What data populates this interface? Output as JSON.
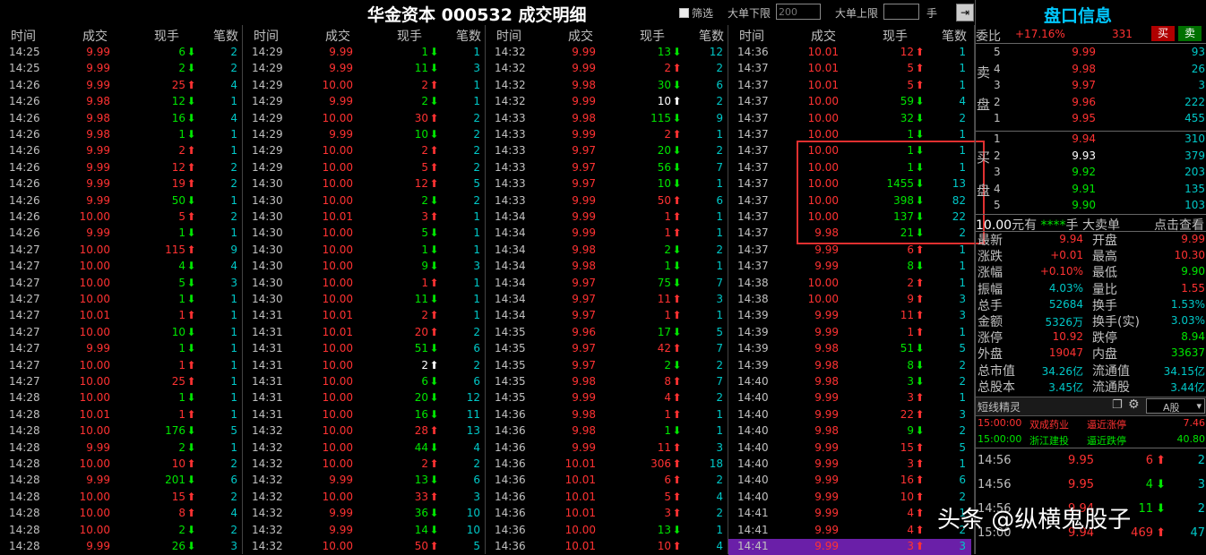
{
  "window": {
    "title": "华金资本 000532 成交明细",
    "filter_label": "筛选",
    "min_label": "大单下限",
    "min_value": "200",
    "max_label": "大单上限",
    "max_value": "",
    "unit_label": "手",
    "exit_icon": "exit-arrow-icon"
  },
  "headers": {
    "time": "时间",
    "price": "成交",
    "vol": "现手",
    "count": "笔数"
  },
  "colors": {
    "up": "#ff3232",
    "down": "#00e600",
    "neutral": "#ffffff",
    "count": "#00c8c8",
    "highlight": "#6a1fa8",
    "box": "#e03030"
  },
  "trades": [
    [
      [
        "14:25",
        "9.99",
        "6",
        "d",
        "2"
      ],
      [
        "14:25",
        "9.99",
        "2",
        "d",
        "2"
      ],
      [
        "14:26",
        "9.99",
        "25",
        "u",
        "4"
      ],
      [
        "14:26",
        "9.98",
        "12",
        "d",
        "1"
      ],
      [
        "14:26",
        "9.98",
        "16",
        "d",
        "4"
      ],
      [
        "14:26",
        "9.98",
        "1",
        "d",
        "1"
      ],
      [
        "14:26",
        "9.99",
        "2",
        "u",
        "1"
      ],
      [
        "14:26",
        "9.99",
        "12",
        "u",
        "2"
      ],
      [
        "14:26",
        "9.99",
        "19",
        "u",
        "2"
      ],
      [
        "14:26",
        "9.99",
        "50",
        "d",
        "1"
      ],
      [
        "14:26",
        "10.00",
        "5",
        "u",
        "2"
      ],
      [
        "14:26",
        "9.99",
        "1",
        "d",
        "1"
      ],
      [
        "14:27",
        "10.00",
        "115",
        "u",
        "9"
      ],
      [
        "14:27",
        "10.00",
        "4",
        "d",
        "4"
      ],
      [
        "14:27",
        "10.00",
        "5",
        "d",
        "3"
      ],
      [
        "14:27",
        "10.00",
        "1",
        "d",
        "1"
      ],
      [
        "14:27",
        "10.01",
        "1",
        "u",
        "1"
      ],
      [
        "14:27",
        "10.00",
        "10",
        "d",
        "1"
      ],
      [
        "14:27",
        "9.99",
        "1",
        "d",
        "1"
      ],
      [
        "14:27",
        "10.00",
        "1",
        "u",
        "1"
      ],
      [
        "14:27",
        "10.00",
        "25",
        "u",
        "1"
      ],
      [
        "14:28",
        "10.00",
        "1",
        "d",
        "1"
      ],
      [
        "14:28",
        "10.01",
        "1",
        "u",
        "1"
      ],
      [
        "14:28",
        "10.00",
        "176",
        "d",
        "5"
      ],
      [
        "14:28",
        "9.99",
        "2",
        "d",
        "1"
      ],
      [
        "14:28",
        "10.00",
        "10",
        "u",
        "2"
      ],
      [
        "14:28",
        "9.99",
        "201",
        "d",
        "6"
      ],
      [
        "14:28",
        "10.00",
        "15",
        "u",
        "2"
      ],
      [
        "14:28",
        "10.00",
        "8",
        "u",
        "4"
      ],
      [
        "14:28",
        "10.00",
        "2",
        "d",
        "2"
      ],
      [
        "14:28",
        "9.99",
        "26",
        "d",
        "3"
      ]
    ],
    [
      [
        "14:29",
        "9.99",
        "1",
        "d",
        "1"
      ],
      [
        "14:29",
        "9.99",
        "11",
        "d",
        "3"
      ],
      [
        "14:29",
        "10.00",
        "2",
        "u",
        "1"
      ],
      [
        "14:29",
        "9.99",
        "2",
        "d",
        "1"
      ],
      [
        "14:29",
        "10.00",
        "30",
        "u",
        "2"
      ],
      [
        "14:29",
        "9.99",
        "10",
        "d",
        "2"
      ],
      [
        "14:29",
        "10.00",
        "2",
        "u",
        "2"
      ],
      [
        "14:29",
        "10.00",
        "5",
        "u",
        "2"
      ],
      [
        "14:30",
        "10.00",
        "12",
        "u",
        "5"
      ],
      [
        "14:30",
        "10.00",
        "2",
        "d",
        "2"
      ],
      [
        "14:30",
        "10.01",
        "3",
        "u",
        "1"
      ],
      [
        "14:30",
        "10.00",
        "5",
        "d",
        "1"
      ],
      [
        "14:30",
        "10.00",
        "1",
        "d",
        "1"
      ],
      [
        "14:30",
        "10.00",
        "9",
        "d",
        "3"
      ],
      [
        "14:30",
        "10.00",
        "1",
        "u",
        "1"
      ],
      [
        "14:30",
        "10.00",
        "11",
        "d",
        "1"
      ],
      [
        "14:31",
        "10.01",
        "2",
        "u",
        "1"
      ],
      [
        "14:31",
        "10.01",
        "20",
        "u",
        "2"
      ],
      [
        "14:31",
        "10.00",
        "51",
        "d",
        "6"
      ],
      [
        "14:31",
        "10.00",
        "2",
        "w",
        "2"
      ],
      [
        "14:31",
        "10.00",
        "6",
        "d",
        "6"
      ],
      [
        "14:31",
        "10.00",
        "20",
        "d",
        "12"
      ],
      [
        "14:31",
        "10.00",
        "16",
        "d",
        "11"
      ],
      [
        "14:32",
        "10.00",
        "28",
        "u",
        "13"
      ],
      [
        "14:32",
        "10.00",
        "44",
        "d",
        "4"
      ],
      [
        "14:32",
        "10.00",
        "2",
        "u",
        "2"
      ],
      [
        "14:32",
        "9.99",
        "13",
        "d",
        "6"
      ],
      [
        "14:32",
        "10.00",
        "33",
        "u",
        "3"
      ],
      [
        "14:32",
        "9.99",
        "36",
        "d",
        "10"
      ],
      [
        "14:32",
        "9.99",
        "14",
        "d",
        "10"
      ],
      [
        "14:32",
        "10.00",
        "50",
        "u",
        "5"
      ]
    ],
    [
      [
        "14:32",
        "9.99",
        "13",
        "d",
        "12"
      ],
      [
        "14:32",
        "9.99",
        "2",
        "u",
        "2"
      ],
      [
        "14:32",
        "9.98",
        "30",
        "d",
        "6"
      ],
      [
        "14:32",
        "9.99",
        "10",
        "w",
        "2"
      ],
      [
        "14:33",
        "9.98",
        "115",
        "d",
        "9"
      ],
      [
        "14:33",
        "9.99",
        "2",
        "u",
        "1"
      ],
      [
        "14:33",
        "9.97",
        "20",
        "d",
        "2"
      ],
      [
        "14:33",
        "9.97",
        "56",
        "d",
        "7"
      ],
      [
        "14:33",
        "9.97",
        "10",
        "d",
        "1"
      ],
      [
        "14:33",
        "9.99",
        "50",
        "u",
        "6"
      ],
      [
        "14:34",
        "9.99",
        "1",
        "u",
        "1"
      ],
      [
        "14:34",
        "9.99",
        "1",
        "u",
        "1"
      ],
      [
        "14:34",
        "9.98",
        "2",
        "d",
        "2"
      ],
      [
        "14:34",
        "9.98",
        "1",
        "d",
        "1"
      ],
      [
        "14:34",
        "9.97",
        "75",
        "d",
        "7"
      ],
      [
        "14:34",
        "9.97",
        "11",
        "u",
        "3"
      ],
      [
        "14:34",
        "9.97",
        "1",
        "u",
        "1"
      ],
      [
        "14:35",
        "9.96",
        "17",
        "d",
        "5"
      ],
      [
        "14:35",
        "9.97",
        "42",
        "u",
        "7"
      ],
      [
        "14:35",
        "9.97",
        "2",
        "d",
        "2"
      ],
      [
        "14:35",
        "9.98",
        "8",
        "u",
        "7"
      ],
      [
        "14:35",
        "9.99",
        "4",
        "u",
        "2"
      ],
      [
        "14:36",
        "9.98",
        "1",
        "u",
        "1"
      ],
      [
        "14:36",
        "9.98",
        "1",
        "d",
        "1"
      ],
      [
        "14:36",
        "9.99",
        "11",
        "u",
        "3"
      ],
      [
        "14:36",
        "10.01",
        "306",
        "u",
        "18"
      ],
      [
        "14:36",
        "10.01",
        "6",
        "u",
        "2"
      ],
      [
        "14:36",
        "10.01",
        "5",
        "u",
        "4"
      ],
      [
        "14:36",
        "10.01",
        "3",
        "u",
        "2"
      ],
      [
        "14:36",
        "10.00",
        "13",
        "d",
        "1"
      ],
      [
        "14:36",
        "10.01",
        "10",
        "u",
        "4"
      ]
    ],
    [
      [
        "14:36",
        "10.01",
        "12",
        "u",
        "1"
      ],
      [
        "14:37",
        "10.01",
        "5",
        "u",
        "1"
      ],
      [
        "14:37",
        "10.01",
        "5",
        "u",
        "1"
      ],
      [
        "14:37",
        "10.00",
        "59",
        "d",
        "4"
      ],
      [
        "14:37",
        "10.00",
        "32",
        "d",
        "2"
      ],
      [
        "14:37",
        "10.00",
        "1",
        "d",
        "1"
      ],
      [
        "14:37",
        "10.00",
        "1",
        "d",
        "1"
      ],
      [
        "14:37",
        "10.00",
        "1",
        "d",
        "1"
      ],
      [
        "14:37",
        "10.00",
        "1455",
        "d",
        "13"
      ],
      [
        "14:37",
        "10.00",
        "398",
        "d",
        "82"
      ],
      [
        "14:37",
        "10.00",
        "137",
        "d",
        "22"
      ],
      [
        "14:37",
        "9.98",
        "21",
        "d",
        "2"
      ],
      [
        "14:37",
        "9.99",
        "6",
        "u",
        "1"
      ],
      [
        "14:37",
        "9.99",
        "8",
        "d",
        "1"
      ],
      [
        "14:38",
        "10.00",
        "2",
        "u",
        "1"
      ],
      [
        "14:38",
        "10.00",
        "9",
        "u",
        "3"
      ],
      [
        "14:39",
        "9.99",
        "11",
        "u",
        "3"
      ],
      [
        "14:39",
        "9.99",
        "1",
        "u",
        "1"
      ],
      [
        "14:39",
        "9.98",
        "51",
        "d",
        "5"
      ],
      [
        "14:39",
        "9.98",
        "8",
        "d",
        "2"
      ],
      [
        "14:40",
        "9.98",
        "3",
        "d",
        "2"
      ],
      [
        "14:40",
        "9.99",
        "3",
        "u",
        "1"
      ],
      [
        "14:40",
        "9.99",
        "22",
        "u",
        "3"
      ],
      [
        "14:40",
        "9.98",
        "9",
        "d",
        "2"
      ],
      [
        "14:40",
        "9.99",
        "15",
        "u",
        "5"
      ],
      [
        "14:40",
        "9.99",
        "3",
        "u",
        "1"
      ],
      [
        "14:40",
        "9.99",
        "16",
        "u",
        "6"
      ],
      [
        "14:40",
        "9.99",
        "10",
        "u",
        "2"
      ],
      [
        "14:41",
        "9.99",
        "4",
        "u",
        "1"
      ],
      [
        "14:41",
        "9.99",
        "4",
        "u",
        "2"
      ],
      [
        "14:41",
        "9.99",
        "3",
        "u",
        "3"
      ]
    ]
  ],
  "panel": {
    "title": "盘口信息",
    "ratio_label": "委比",
    "ratio_value": "+17.16%",
    "ratio_diff": "331",
    "buy_btn": "买",
    "sell_btn": "卖",
    "sell_side_label": [
      "卖",
      "盘"
    ],
    "buy_side_label": [
      "买",
      "盘"
    ],
    "asks": [
      [
        "5",
        "9.99",
        "93"
      ],
      [
        "4",
        "9.98",
        "26"
      ],
      [
        "3",
        "9.97",
        "3"
      ],
      [
        "2",
        "9.96",
        "222"
      ],
      [
        "1",
        "9.95",
        "455"
      ]
    ],
    "bids": [
      [
        "1",
        "9.94",
        "310"
      ],
      [
        "2",
        "9.93",
        "379"
      ],
      [
        "3",
        "9.92",
        "203"
      ],
      [
        "4",
        "9.91",
        "135"
      ],
      [
        "5",
        "9.90",
        "103"
      ]
    ],
    "bigorder_price": "10.00",
    "bigorder_has": "元有",
    "bigorder_stars": "****",
    "bigorder_unit": "手",
    "bigorder_label": "大卖单",
    "bigorder_link": "点击查看",
    "quotes": [
      [
        "最新",
        "9.94",
        "开盘",
        "9.99"
      ],
      [
        "涨跌",
        "+0.01",
        "最高",
        "10.30"
      ],
      [
        "涨幅",
        "+0.10%",
        "最低",
        "9.90"
      ],
      [
        "振幅",
        "4.03%",
        "量比",
        "1.55"
      ],
      [
        "总手",
        "52684",
        "换手",
        "1.53%"
      ],
      [
        "金额",
        "5326万",
        "换手(实)",
        "3.03%"
      ],
      [
        "涨停",
        "10.92",
        "跌停",
        "8.94"
      ],
      [
        "外盘",
        "19047",
        "内盘",
        "33637"
      ],
      [
        "总市值",
        "34.26亿",
        "流通值",
        "34.15亿"
      ],
      [
        "总股本",
        "3.45亿",
        "流通股",
        "3.44亿"
      ]
    ],
    "short_title": "短线精灵",
    "market_select": "A股",
    "short_items": [
      [
        "15:00:00",
        "双成药业",
        "逼近涨停",
        "7.46"
      ],
      [
        "15:00:00",
        "浙江建投",
        "逼近跌停",
        "40.80"
      ]
    ],
    "mini_trades": [
      [
        "14:56",
        "9.95",
        "6",
        "u",
        "2"
      ],
      [
        "14:56",
        "9.95",
        "4",
        "d",
        "3"
      ],
      [
        "14:56",
        "9.94",
        "11",
        "d",
        "2"
      ],
      [
        "15:00",
        "9.94",
        "469",
        "u",
        "47"
      ]
    ]
  },
  "watermark": "头条 @纵横鬼股子"
}
